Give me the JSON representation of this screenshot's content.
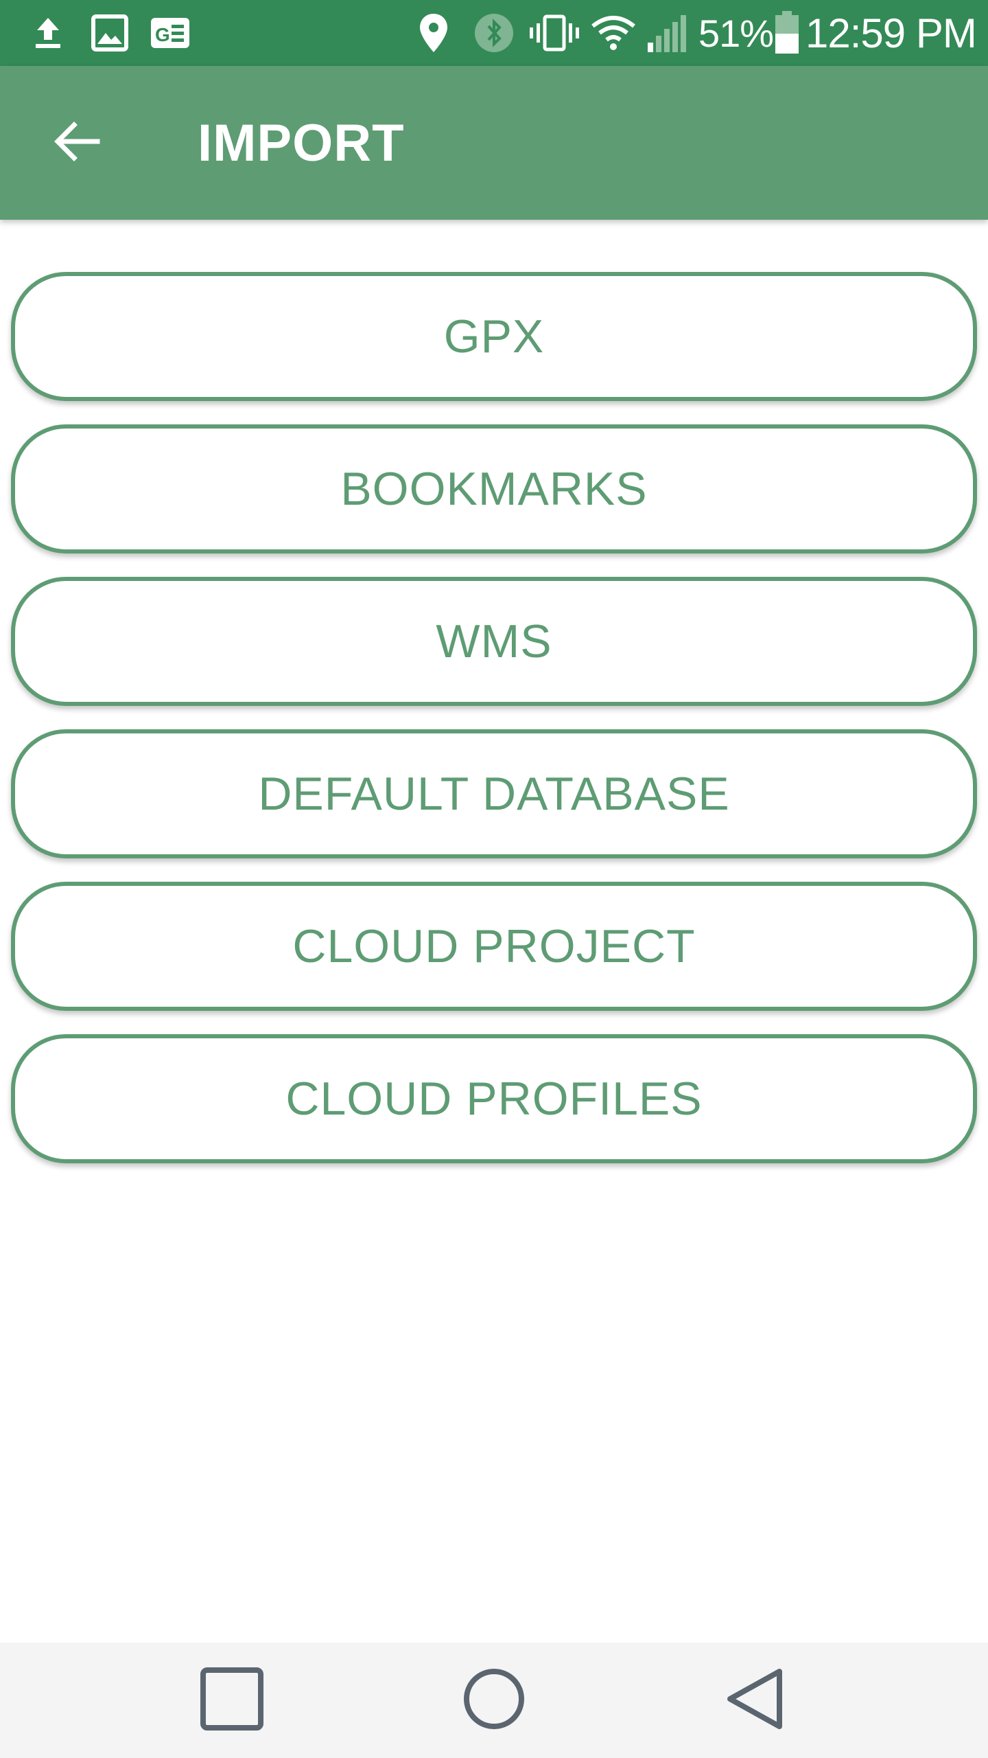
{
  "status_bar": {
    "battery_percent": "51%",
    "time": "12:59 PM",
    "icons": [
      "upload-icon",
      "image-icon",
      "news-icon",
      "location-icon",
      "bluetooth-icon",
      "vibrate-icon",
      "wifi-icon",
      "signal-icon",
      "battery-icon"
    ],
    "battery_level": 0.51
  },
  "app_bar": {
    "title": "IMPORT",
    "back_icon": "arrow-back-icon"
  },
  "buttons": [
    {
      "label": "GPX"
    },
    {
      "label": "BOOKMARKS"
    },
    {
      "label": "WMS"
    },
    {
      "label": "DEFAULT DATABASE"
    },
    {
      "label": "CLOUD PROJECT"
    },
    {
      "label": "CLOUD PROFILES"
    }
  ],
  "nav_bar": {
    "icons": [
      "recent-apps-icon",
      "home-icon",
      "back-icon"
    ]
  },
  "colors": {
    "status_bar": "#338a56",
    "app_bar": "#5e9c74",
    "accent": "#5e9c74",
    "nav_bar": "#f4f4f4",
    "nav_icon": "#5b6570"
  }
}
